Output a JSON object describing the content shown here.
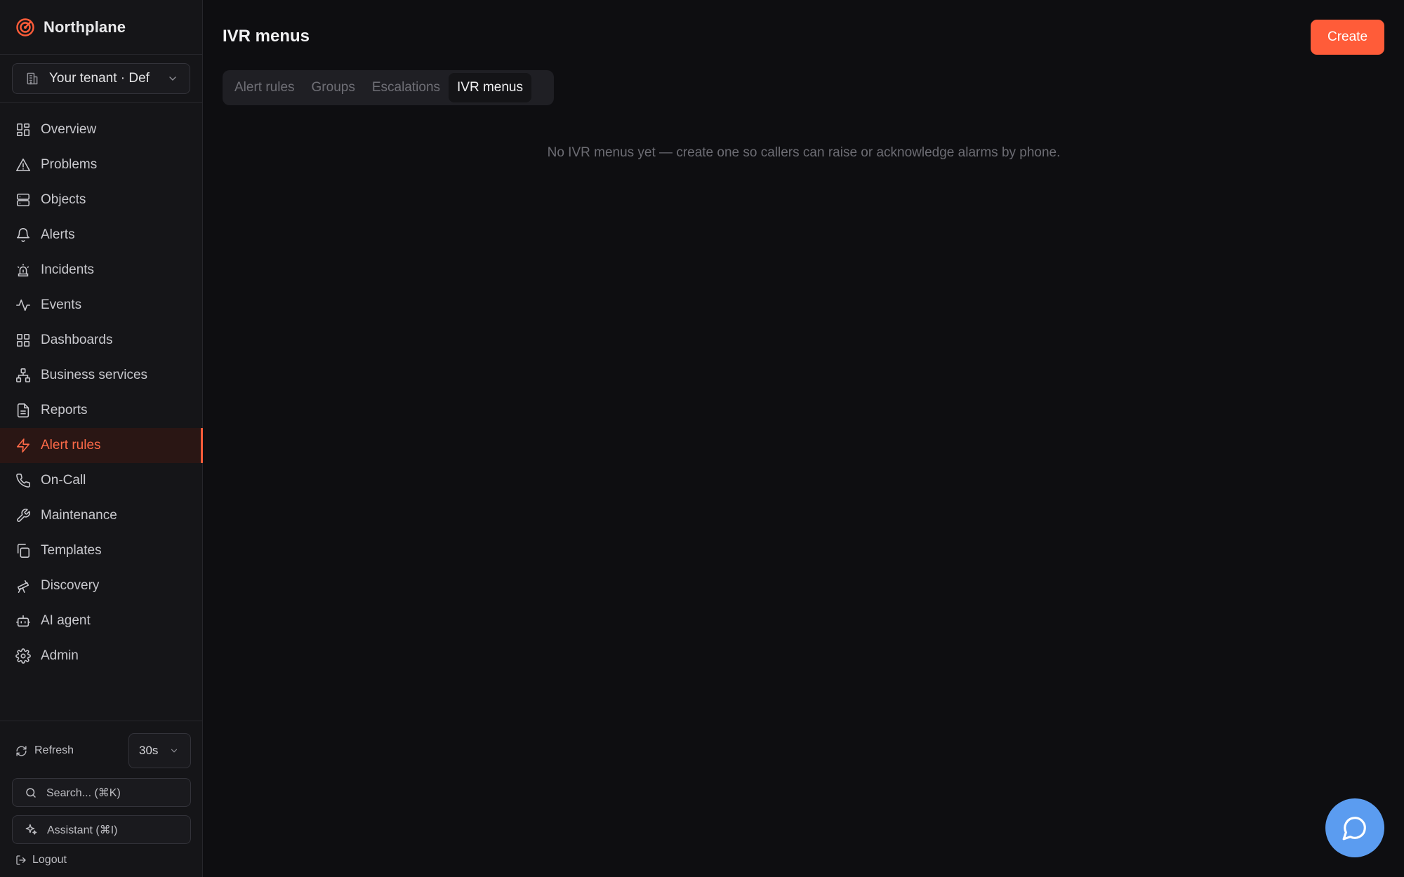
{
  "app": {
    "name": "Northplane"
  },
  "tenant": {
    "label": "Your tenant · Def"
  },
  "sidebar": {
    "items": [
      {
        "label": "Overview",
        "icon": "layout-dashboard-icon"
      },
      {
        "label": "Problems",
        "icon": "alert-triangle-icon"
      },
      {
        "label": "Objects",
        "icon": "server-icon"
      },
      {
        "label": "Alerts",
        "icon": "bell-icon"
      },
      {
        "label": "Incidents",
        "icon": "siren-icon"
      },
      {
        "label": "Events",
        "icon": "activity-icon"
      },
      {
        "label": "Dashboards",
        "icon": "grid-icon"
      },
      {
        "label": "Business services",
        "icon": "network-icon"
      },
      {
        "label": "Reports",
        "icon": "file-text-icon"
      },
      {
        "label": "Alert rules",
        "icon": "zap-icon",
        "active": true
      },
      {
        "label": "On-Call",
        "icon": "phone-icon"
      },
      {
        "label": "Maintenance",
        "icon": "wrench-icon"
      },
      {
        "label": "Templates",
        "icon": "copy-icon"
      },
      {
        "label": "Discovery",
        "icon": "telescope-icon"
      },
      {
        "label": "AI agent",
        "icon": "bot-icon"
      },
      {
        "label": "Admin",
        "icon": "gear-icon"
      }
    ],
    "refresh_label": "Refresh",
    "interval_value": "30s",
    "search_placeholder": "Search... (⌘K)",
    "assistant_label": "Assistant (⌘I)",
    "logout_label": "Logout"
  },
  "main": {
    "title": "IVR menus",
    "create_label": "Create",
    "tabs": [
      {
        "label": "Alert rules",
        "active": false
      },
      {
        "label": "Groups",
        "active": false
      },
      {
        "label": "Escalations",
        "active": false
      },
      {
        "label": "IVR menus",
        "active": true
      }
    ],
    "empty_message": "No IVR menus yet — create one so callers can raise or acknowledge alarms by phone."
  },
  "colors": {
    "accent": "#ff5c39",
    "background": "#0e0e11",
    "sidebar_bg": "#151518",
    "chat_button": "#5b9cf0"
  }
}
